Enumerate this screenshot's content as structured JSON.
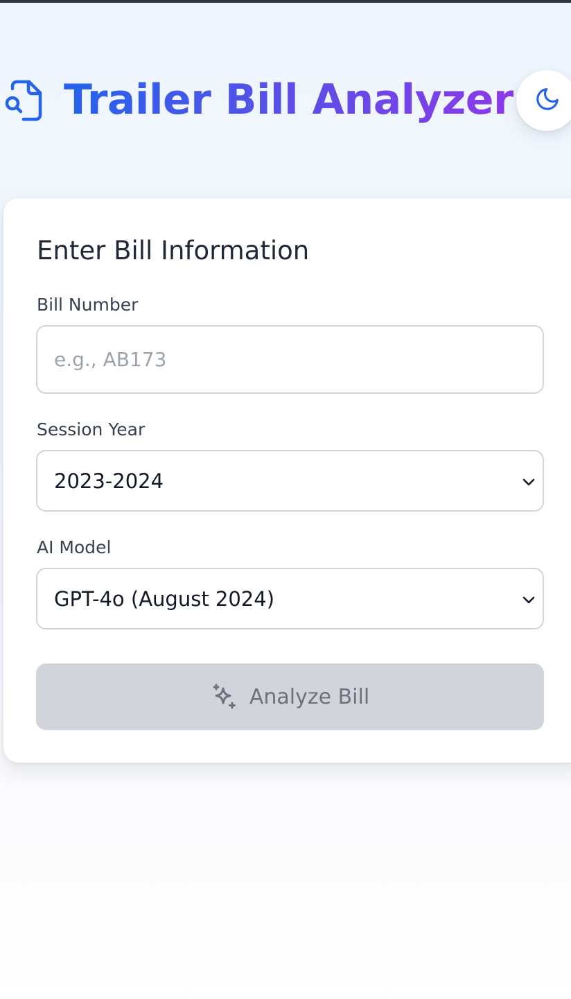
{
  "header": {
    "title": "Trailer Bill Analyzer",
    "logo_icon": "file-search-icon",
    "theme_toggle_icon": "moon-icon"
  },
  "form": {
    "title": "Enter Bill Information",
    "bill_number": {
      "label": "Bill Number",
      "value": "",
      "placeholder": "e.g., AB173"
    },
    "session_year": {
      "label": "Session Year",
      "selected": "2023-2024",
      "icon": "chevron-down-icon"
    },
    "ai_model": {
      "label": "AI Model",
      "selected": "GPT-4o (August 2024)",
      "icon": "chevron-down-icon"
    },
    "submit": {
      "label": "Analyze Bill",
      "icon": "sparkles-icon",
      "disabled": true
    }
  },
  "colors": {
    "title_gradient_start": "#2563eb",
    "title_gradient_end": "#8b3ae9",
    "accent": "#2563eb",
    "button_disabled_bg": "#d1d5db",
    "button_disabled_text": "#6b7280"
  }
}
